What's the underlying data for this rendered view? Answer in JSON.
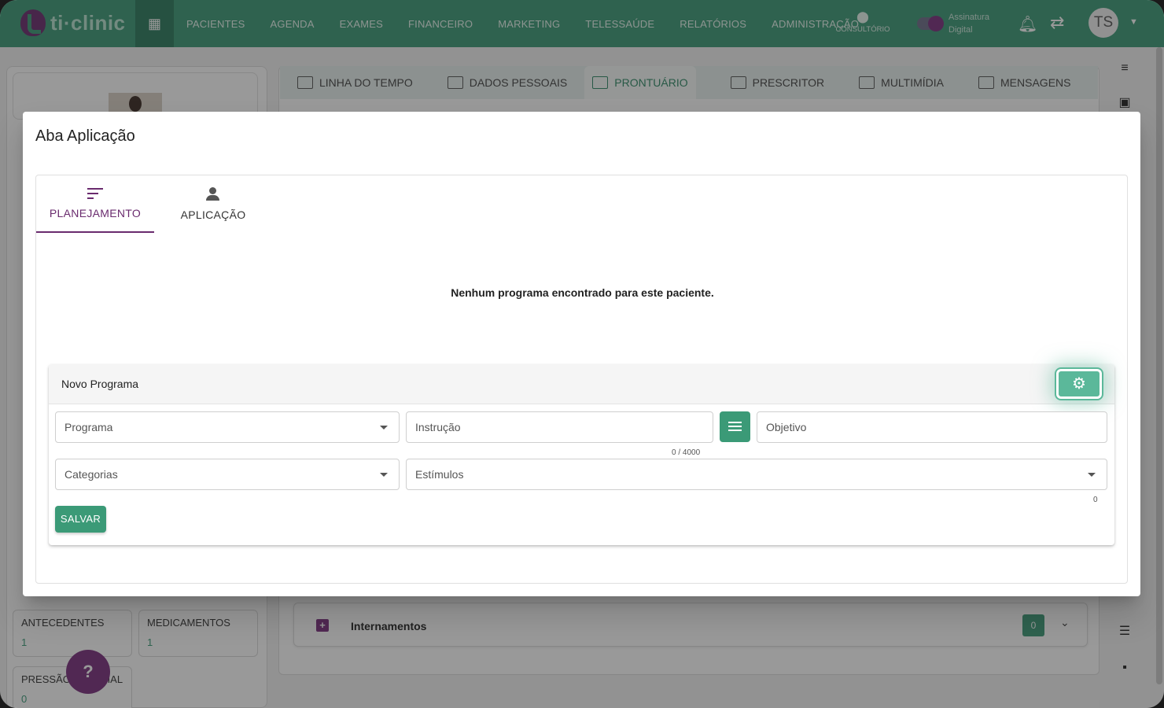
{
  "app": {
    "logo_text": "ti·clinic"
  },
  "nav": {
    "items": [
      "PACIENTES",
      "AGENDA",
      "EXAMES",
      "FINANCEIRO",
      "MARKETING",
      "TELESSAÚDE",
      "RELATÓRIOS",
      "ADMINISTRAÇÃO"
    ],
    "location_label": "CONSULTÓRIO",
    "signature_line1": "Assinatura",
    "signature_line2": "Digital",
    "avatar_initials": "TS"
  },
  "patient_tabs": [
    "LINHA DO TEMPO",
    "DADOS PESSOAIS",
    "PRONTUÁRIO",
    "PRESCRITOR",
    "MULTIMÍDIA",
    "MENSAGENS"
  ],
  "sidebar_cards": [
    {
      "title": "ANTECEDENTES",
      "count": "1"
    },
    {
      "title": "MEDICAMENTOS",
      "count": "1"
    },
    {
      "title": "PRESSÃO ARTERIAL",
      "count": "0"
    }
  ],
  "background": {
    "internamentos_label": "Internamentos",
    "internamentos_count": "0"
  },
  "dialog": {
    "title": "Aba Aplicação",
    "tabs": [
      {
        "label": "PLANEJAMENTO",
        "icon": "sort-lines-icon",
        "active": true
      },
      {
        "label": "APLICAÇÃO",
        "icon": "person-icon",
        "active": false
      }
    ],
    "empty_message": "Nenhum programa encontrado para este paciente.",
    "new_program": {
      "title": "Novo Programa",
      "fields": {
        "programa": "Programa",
        "instrucao": "Instrução",
        "objetivo": "Objetivo",
        "categorias": "Categorias",
        "estimulos": "Estímulos"
      },
      "instrucao_counter": "0 / 4000",
      "estimulos_counter": "0",
      "save_label": "SALVAR"
    }
  },
  "colors": {
    "brand_green": "#3b9a77",
    "brand_purple": "#6a2b6e",
    "highlight_green": "#5bb89a"
  }
}
